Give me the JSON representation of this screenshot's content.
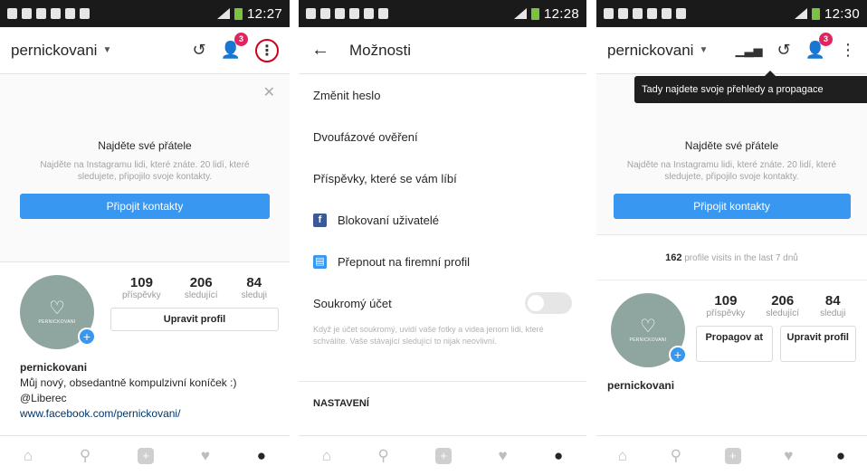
{
  "phone1": {
    "status": {
      "time": "12:27"
    },
    "topbar": {
      "username": "pernickovani",
      "badge": "3"
    },
    "suggest": {
      "title": "Najděte své přátele",
      "desc": "Najděte na Instagramu lidi, které znáte. 20 lidí, které sledujete, připojilo svoje kontakty.",
      "button": "Připojit kontakty"
    },
    "avatar": {
      "text": "PERNICKOVANI"
    },
    "stats": [
      {
        "num": "109",
        "label": "příspěvky"
      },
      {
        "num": "206",
        "label": "sledující"
      },
      {
        "num": "84",
        "label": "sleduji"
      }
    ],
    "edit_button": "Upravit profil",
    "bio": {
      "name": "pernickovani",
      "line1": "Můj nový, obsedantně kompulzivní koníček :)",
      "line2": "@Liberec",
      "link": "www.facebook.com/pernickovani/"
    }
  },
  "phone2": {
    "status": {
      "time": "12:28"
    },
    "title": "Možnosti",
    "items": {
      "change_password": "Změnit heslo",
      "two_factor": "Dvoufázové ověření",
      "liked_posts": "Příspěvky, které se vám líbí",
      "blocked_users": "Blokovaní uživatelé",
      "switch_business": "Přepnout na firemní profil",
      "private_account": "Soukromý účet"
    },
    "private_desc": "Když je účet soukromý, uvidí vaše fotky a videa jenom lidi, které schválíte. Vaše stávající sledující to nijak neovlivní.",
    "section": "NASTAVENÍ"
  },
  "phone3": {
    "status": {
      "time": "12:30"
    },
    "topbar": {
      "username": "pernickovani",
      "badge": "3"
    },
    "tooltip": "Tady najdete svoje přehledy a propagace",
    "suggest": {
      "title": "Najděte své přátele",
      "desc": "Najděte na Instagramu lidi, které znáte. 20 lidí, které sledujete, připojilo svoje kontakty.",
      "button": "Připojit kontakty"
    },
    "visits": {
      "count": "162",
      "text": "profile visits in the last 7 dnů"
    },
    "avatar": {
      "text": "PERNICKOVANI"
    },
    "stats": [
      {
        "num": "109",
        "label": "příspěvky"
      },
      {
        "num": "206",
        "label": "sledující"
      },
      {
        "num": "84",
        "label": "sleduji"
      }
    ],
    "promote_button": "Propagov at",
    "edit_button": "Upravit profil",
    "bio": {
      "name": "pernickovani"
    }
  },
  "icons": {
    "history": "history-icon",
    "follow_requests": "add-person-icon",
    "more": "more-vertical-icon",
    "insights": "bar-chart-icon",
    "home": "home-icon",
    "search": "search-icon",
    "add": "plus-icon",
    "activity": "heart-icon",
    "profile": "person-icon",
    "facebook": "facebook-icon",
    "business": "business-icon"
  },
  "colors": {
    "accent": "#3897f0",
    "badge": "#e0245e",
    "facebook": "#3b5998",
    "highlight": "#d0021b"
  }
}
